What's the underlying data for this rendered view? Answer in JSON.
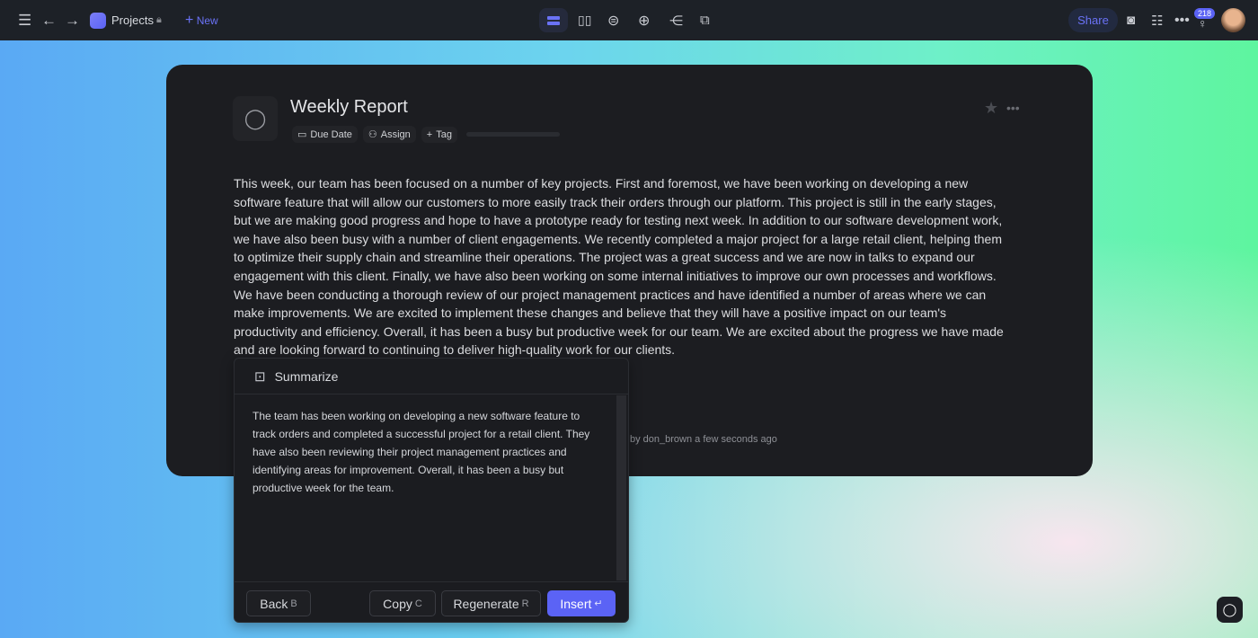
{
  "topbar": {
    "project": "Projects",
    "new_label": "New",
    "share_label": "Share",
    "notification_count": "218",
    "accent": "#5b63f5"
  },
  "doc": {
    "title": "Weekly Report",
    "due_date": "Due Date",
    "assign": "Assign",
    "tag": "Tag",
    "body": "This week, our team has been focused on a number of key projects. First and foremost, we have been working on developing a new software feature that will allow our customers to more easily track their orders through our platform. This project is still in the early stages, but we are making good progress and hope to have a prototype ready for testing next week. In addition to our software development work, we have also been busy with a number of client engagements. We recently completed a major project for a large retail client, helping them to optimize their supply chain and streamline their operations. The project was a great success and we are now in talks to expand our engagement with this client. Finally, we have also been working on some internal initiatives to improve our own processes and workflows. We have been conducting a thorough review of our project management practices and have identified a number of areas where we can make improvements. We are excited to implement these changes and believe that they will have a positive impact on our team's productivity and efficiency. Overall, it has been a busy but productive week for our team. We are excited about the progress we have made and are looking forward to continuing to deliver high-quality work for our clients.",
    "meta": "by don_brown a few seconds ago"
  },
  "popup": {
    "title": "Summarize",
    "summary": "The team has been working on developing a new software feature to track orders and completed a successful project for a retail client. They have also been reviewing their project management practices and identifying areas for improvement. Overall, it has been a busy but productive week for the team.",
    "back": "Back",
    "back_key": "B",
    "copy": "Copy",
    "copy_key": "C",
    "regenerate": "Regenerate",
    "regenerate_key": "R",
    "insert": "Insert",
    "insert_key": "↵"
  }
}
